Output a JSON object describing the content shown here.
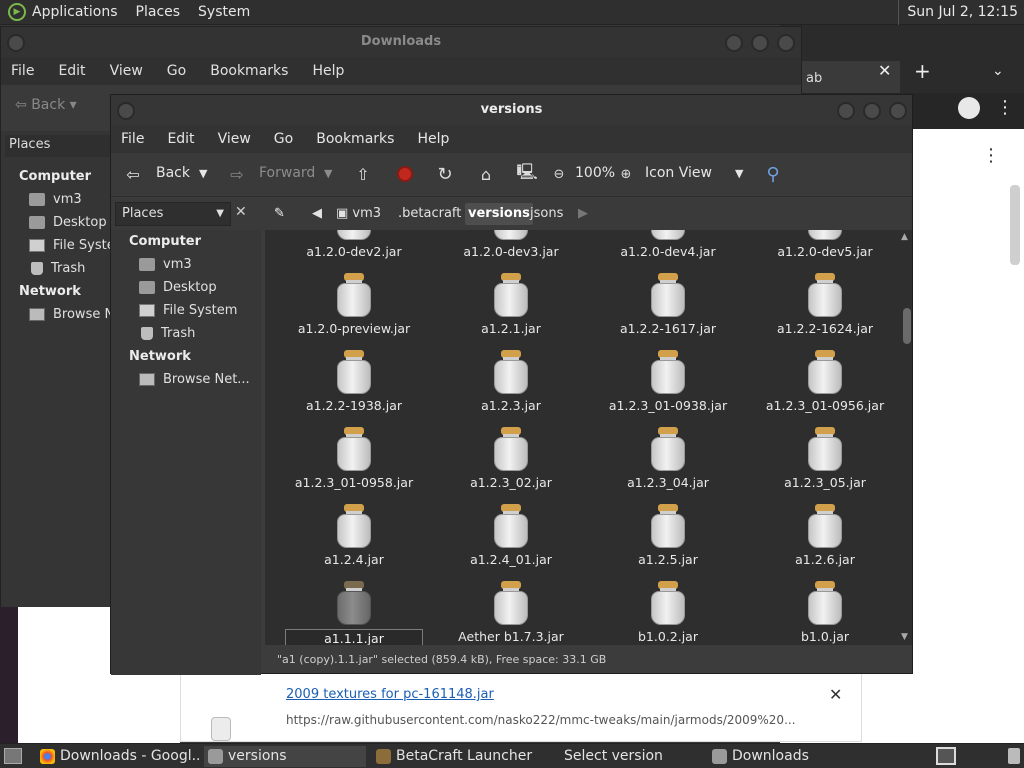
{
  "top_panel": {
    "menus": [
      "Applications",
      "Places",
      "System"
    ],
    "clock": "Sun Jul  2, 12:15"
  },
  "downloads_window": {
    "title": "Downloads",
    "menus": [
      "File",
      "Edit",
      "View",
      "Go",
      "Bookmarks",
      "Help"
    ],
    "back_label": "Back",
    "places_label": "Places",
    "sidebar": {
      "computer_heading": "Computer",
      "items": [
        "vm3",
        "Desktop",
        "File System",
        "Trash"
      ],
      "network_heading": "Network",
      "network_items": [
        "Browse Network"
      ]
    }
  },
  "browser": {
    "tab_label": "ab",
    "download": {
      "title": "2009 textures for pc-161148.jar",
      "url": "https://raw.githubusercontent.com/nasko222/mmc-tweaks/main/jarmods/2009%20..."
    }
  },
  "versions_window": {
    "title": "versions",
    "menus": [
      "File",
      "Edit",
      "View",
      "Go",
      "Bookmarks",
      "Help"
    ],
    "toolbar": {
      "back": "Back",
      "forward": "Forward",
      "zoom": "100%",
      "view_mode": "Icon View"
    },
    "location": {
      "places_combo": "Places",
      "crumbs": [
        "vm3",
        ".betacraft",
        "versions",
        "jsons"
      ],
      "active_crumb": "versions"
    },
    "sidebar": {
      "computer_heading": "Computer",
      "items": [
        "vm3",
        "Desktop",
        "File System",
        "Trash"
      ],
      "network_heading": "Network",
      "network_items": [
        "Browse Net..."
      ]
    },
    "files": [
      "a1.2.0-dev2.jar",
      "a1.2.0-dev3.jar",
      "a1.2.0-dev4.jar",
      "a1.2.0-dev5.jar",
      "a1.2.0-preview.jar",
      "a1.2.1.jar",
      "a1.2.2-1617.jar",
      "a1.2.2-1624.jar",
      "a1.2.2-1938.jar",
      "a1.2.3.jar",
      "a1.2.3_01-0938.jar",
      "a1.2.3_01-0956.jar",
      "a1.2.3_01-0958.jar",
      "a1.2.3_02.jar",
      "a1.2.3_04.jar",
      "a1.2.3_05.jar",
      "a1.2.4.jar",
      "a1.2.4_01.jar",
      "a1.2.5.jar",
      "a1.2.6.jar",
      "a1.1.1.jar",
      "Aether b1.7.3.jar",
      "b1.0.2.jar",
      "b1.0.jar"
    ],
    "renaming_value": "a1.1.1.jar",
    "status": "\"a1 (copy).1.1.jar\" selected (859.4 kB), Free space: 33.1 GB"
  },
  "taskbar": {
    "tasks": [
      "Downloads - Googl...",
      "versions",
      "BetaCraft Launcher ...",
      "Select version",
      "Downloads"
    ]
  }
}
